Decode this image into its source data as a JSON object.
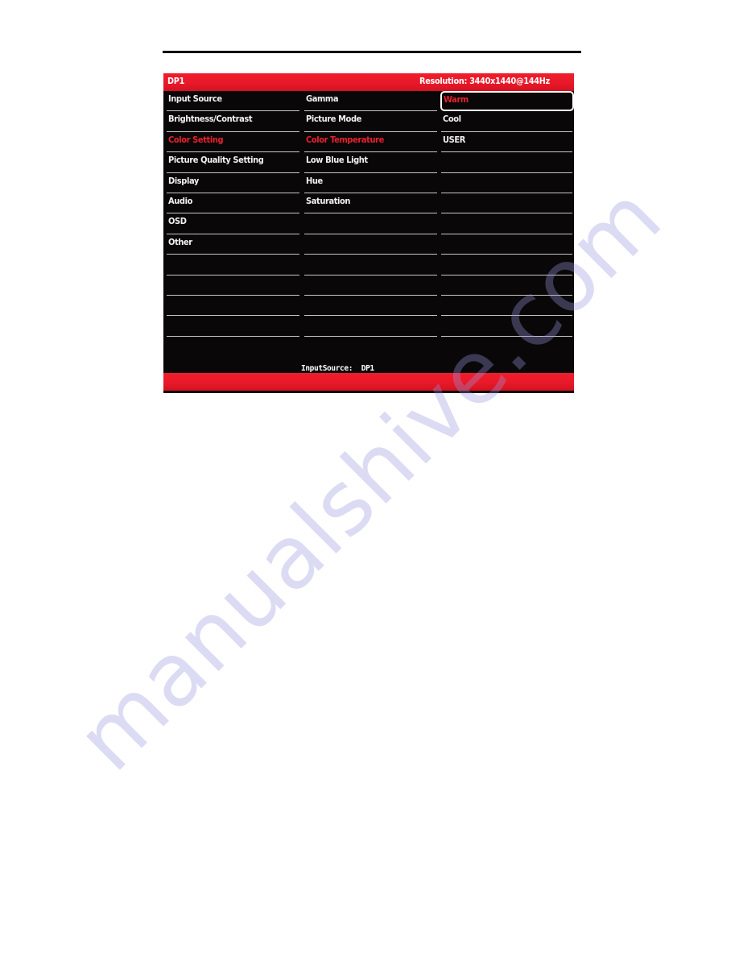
{
  "watermark": {
    "text": "manualshive.com"
  },
  "osd": {
    "header": {
      "input_source": "DP1",
      "resolution_label": "Resolution:  3440x1440@144Hz"
    },
    "accent_red": "#e8202e",
    "background": "#0a0708",
    "columns": [
      {
        "name": "main-menu",
        "items": [
          {
            "label": "Input Source",
            "selected": false,
            "boxed": false
          },
          {
            "label": "Brightness/Contrast",
            "selected": false,
            "boxed": false
          },
          {
            "label": "Color Setting",
            "selected": true,
            "boxed": false
          },
          {
            "label": "Picture Quality Setting",
            "selected": false,
            "boxed": false
          },
          {
            "label": "Display",
            "selected": false,
            "boxed": false
          },
          {
            "label": "Audio",
            "selected": false,
            "boxed": false
          },
          {
            "label": "OSD",
            "selected": false,
            "boxed": false
          },
          {
            "label": "Other",
            "selected": false,
            "boxed": false
          },
          {
            "label": "",
            "selected": false,
            "boxed": false
          },
          {
            "label": "",
            "selected": false,
            "boxed": false
          },
          {
            "label": "",
            "selected": false,
            "boxed": false
          },
          {
            "label": "",
            "selected": false,
            "boxed": false
          }
        ]
      },
      {
        "name": "submenu",
        "items": [
          {
            "label": "Gamma",
            "selected": false,
            "boxed": false
          },
          {
            "label": "Picture Mode",
            "selected": false,
            "boxed": false
          },
          {
            "label": "Color Temperature",
            "selected": true,
            "boxed": false
          },
          {
            "label": "Low Blue Light",
            "selected": false,
            "boxed": false
          },
          {
            "label": "Hue",
            "selected": false,
            "boxed": false
          },
          {
            "label": "Saturation",
            "selected": false,
            "boxed": false
          },
          {
            "label": "",
            "selected": false,
            "boxed": false
          },
          {
            "label": "",
            "selected": false,
            "boxed": false
          },
          {
            "label": "",
            "selected": false,
            "boxed": false
          },
          {
            "label": "",
            "selected": false,
            "boxed": false
          },
          {
            "label": "",
            "selected": false,
            "boxed": false
          },
          {
            "label": "",
            "selected": false,
            "boxed": false
          }
        ]
      },
      {
        "name": "options",
        "items": [
          {
            "label": "Warm",
            "selected": true,
            "boxed": true
          },
          {
            "label": "Cool",
            "selected": false,
            "boxed": false
          },
          {
            "label": "USER",
            "selected": false,
            "boxed": false
          },
          {
            "label": "",
            "selected": false,
            "boxed": false
          },
          {
            "label": "",
            "selected": false,
            "boxed": false
          },
          {
            "label": "",
            "selected": false,
            "boxed": false
          },
          {
            "label": "",
            "selected": false,
            "boxed": false
          },
          {
            "label": "",
            "selected": false,
            "boxed": false
          },
          {
            "label": "",
            "selected": false,
            "boxed": false
          },
          {
            "label": "",
            "selected": false,
            "boxed": false
          },
          {
            "label": "",
            "selected": false,
            "boxed": false
          },
          {
            "label": "",
            "selected": false,
            "boxed": false
          }
        ]
      }
    ],
    "info": {
      "input_source_line": "InputSource:  DP1",
      "resolution_line": "Resolution:  3440x1440@144Hz"
    }
  }
}
